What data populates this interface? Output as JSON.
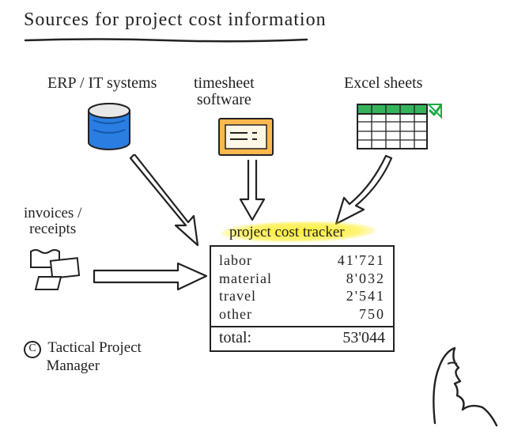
{
  "title": "Sources for project cost information",
  "sources": {
    "erp": {
      "label": "ERP / IT systems"
    },
    "timesheet": {
      "label_line1": "timesheet",
      "label_line2": "software"
    },
    "excel": {
      "label": "Excel sheets"
    },
    "invoices": {
      "label_line1": "invoices /",
      "label_line2": "receipts"
    }
  },
  "tracker": {
    "label": "project cost tracker",
    "rows": [
      {
        "label": "labor",
        "value": "41'721"
      },
      {
        "label": "material",
        "value": "8'032"
      },
      {
        "label": "travel",
        "value": "2'541"
      },
      {
        "label": "other",
        "value": "750"
      }
    ],
    "total_label": "total:",
    "total_value": "53'044"
  },
  "credit": {
    "symbol": "C",
    "line1": "Tactical Project",
    "line2": "Manager"
  }
}
